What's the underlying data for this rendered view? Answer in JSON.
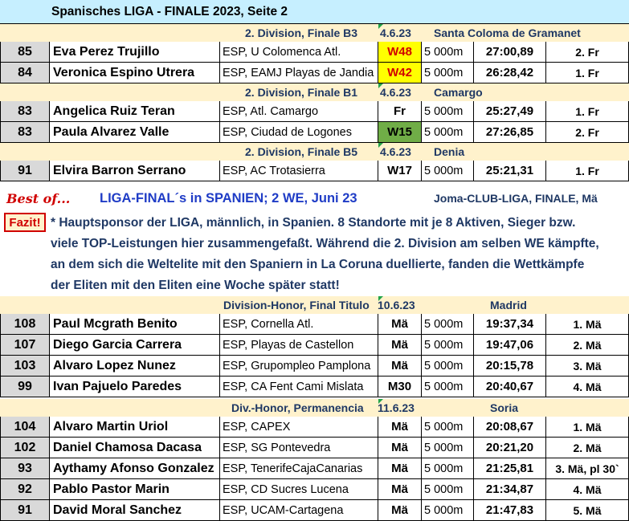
{
  "title": "Spanisches LIGA - FINALE 2023, Seite 2",
  "sections": [
    {
      "division": "2. Division, Finale B3",
      "date": "4.6.23",
      "venue": "Santa Coloma de Gramanet",
      "rows": [
        {
          "num": "85",
          "name": "Eva Perez Trujillo",
          "club": "ESP, U Colomenca Atl.",
          "cat": "W48",
          "cat_bg": "#ffff00",
          "cat_color": "#d00000",
          "dist": "5 000m",
          "time": "27:00,89",
          "place": "2. Fr"
        },
        {
          "num": "84",
          "name": "Veronica Espino Utrera",
          "club": "ESP, EAMJ Playas de Jandia",
          "cat": "W42",
          "cat_bg": "#ffff00",
          "cat_color": "#d00000",
          "dist": "5 000m",
          "time": "26:28,42",
          "place": "1. Fr"
        }
      ]
    },
    {
      "division": "2. Division, Finale B1",
      "date": "4.6.23",
      "venue": "Camargo",
      "rows": [
        {
          "num": "83",
          "name": "Angelica Ruiz Teran",
          "club": "ESP, Atl. Camargo",
          "cat": "Fr",
          "cat_bg": "#ffffff",
          "cat_color": "#000000",
          "dist": "5 000m",
          "time": "25:27,49",
          "place": "1. Fr"
        },
        {
          "num": "83",
          "name": "Paula Alvarez Valle",
          "club": "ESP, Ciudad de Logones",
          "cat": "W15",
          "cat_bg": "#70ad47",
          "cat_color": "#000000",
          "dist": "5 000m",
          "time": "27:26,85",
          "place": "2. Fr"
        }
      ]
    },
    {
      "division": "2. Division, Finale B5",
      "date": "4.6.23",
      "venue": "Denia",
      "rows": [
        {
          "num": "91",
          "name": "Elvira Barron Serrano",
          "club": "ESP, AC Trotasierra",
          "cat": "W17",
          "cat_bg": "#ffffff",
          "cat_color": "#000000",
          "dist": "5 000m",
          "time": "25:21,31",
          "place": "1. Fr"
        }
      ]
    }
  ],
  "bestof": {
    "label": "Best of...",
    "headline": "LIGA-FINAL´s in SPANIEN; 2 WE, Juni 23",
    "right": "Joma-CLUB-LIGA, FINALE, Mä"
  },
  "fazit": {
    "badge": "Fazit!",
    "lines": [
      "* Hauptsponsor der LIGA, männlich, in Spanien. 8 Standorte mit je 8 Aktiven, Sieger bzw.",
      "viele TOP-Leistungen hier zusammengefaßt. Während die 2. Division am selben WE kämpfte,",
      "an dem sich die Weltelite mit den Spaniern in La Coruna duellierte, fanden die Wettkämpfe",
      "der Eliten mit den Eliten eine Woche später statt!"
    ]
  },
  "sections2": [
    {
      "division": "Division-Honor, Final Titulo",
      "date": "10.6.23",
      "venue": "Madrid",
      "rows": [
        {
          "num": "108",
          "name": "Paul Mcgrath Benito",
          "club": "ESP, Cornella Atl.",
          "cat": "Mä",
          "dist": "5 000m",
          "time": "19:37,34",
          "place": "1. Mä"
        },
        {
          "num": "107",
          "name": "Diego Garcia Carrera",
          "club": "ESP, Playas de Castellon",
          "cat": "Mä",
          "dist": "5 000m",
          "time": "19:47,06",
          "place": "2. Mä"
        },
        {
          "num": "103",
          "name": "Alvaro Lopez Nunez",
          "club": "ESP, Grupompleo Pamplona",
          "cat": "Mä",
          "dist": "5 000m",
          "time": "20:15,78",
          "place": "3. Mä"
        },
        {
          "num": "99",
          "name": "Ivan Pajuelo Paredes",
          "club": "ESP, CA Fent Cami Mislata",
          "cat": "M30",
          "dist": "5 000m",
          "time": "20:40,67",
          "place": "4. Mä"
        }
      ]
    },
    {
      "division": "Div.-Honor, Permanencia",
      "date": "11.6.23",
      "venue": "Soria",
      "rows": [
        {
          "num": "104",
          "name": "Alvaro Martin Uriol",
          "club": "ESP, CAPEX",
          "cat": "Mä",
          "dist": "5 000m",
          "time": "20:08,67",
          "place": "1. Mä"
        },
        {
          "num": "102",
          "name": "Daniel Chamosa Dacasa",
          "club": "ESP, SG Pontevedra",
          "cat": "Mä",
          "dist": "5 000m",
          "time": "20:21,20",
          "place": "2. Mä"
        },
        {
          "num": "93",
          "name": "Aythamy Afonso Gonzalez",
          "club": "ESP, TenerifeCajaCanarias",
          "cat": "Mä",
          "dist": "5 000m",
          "time": "21:25,81",
          "place": "3. Mä, pl 30`"
        },
        {
          "num": "92",
          "name": "Pablo Pastor Marin",
          "club": "ESP, CD Sucres Lucena",
          "cat": "Mä",
          "dist": "5 000m",
          "time": "21:34,87",
          "place": "4. Mä"
        },
        {
          "num": "91",
          "name": "David Moral Sanchez",
          "club": "ESP, UCAM-Cartagena",
          "cat": "Mä",
          "dist": "5 000m",
          "time": "21:47,83",
          "place": "5. Mä"
        }
      ]
    }
  ]
}
